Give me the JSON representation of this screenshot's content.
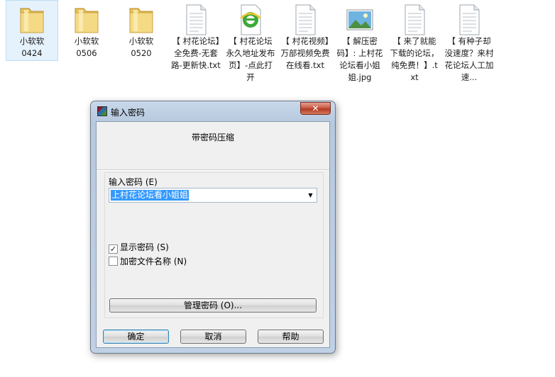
{
  "files": [
    {
      "label": "小软软\n0424",
      "icon": "folder-icon",
      "selected": true
    },
    {
      "label": "小软软\n0506",
      "icon": "folder-icon"
    },
    {
      "label": "小软软\n0520",
      "icon": "folder-icon"
    },
    {
      "label": "【 村花论坛】全免费-无套路-更新快.txt",
      "icon": "text-file-icon"
    },
    {
      "label": "【 村花论坛永久地址发布页】-点此打开",
      "icon": "ie-shortcut-icon"
    },
    {
      "label": "【 村花视频】万部视频免费在线看.txt",
      "icon": "text-file-icon"
    },
    {
      "label": "【 解压密码】: 上村花论坛看小姐姐.jpg",
      "icon": "image-file-icon"
    },
    {
      "label": "【 来了就能下载的论坛，纯免费！】.txt",
      "icon": "text-file-icon"
    },
    {
      "label": "【 有种子却没速度？来村花论坛人工加速...",
      "icon": "text-file-icon"
    }
  ],
  "dialog": {
    "title": "输入密码",
    "close_label": "✕",
    "section_title": "带密码压缩",
    "password_label": "输入密码 (E)",
    "password_value": "上村花论坛看小姐姐",
    "show_password_label": "显示密码 (S)",
    "show_password_checked": true,
    "encrypt_names_label": "加密文件名称 (N)",
    "encrypt_names_checked": false,
    "manage_label": "管理密码 (O)...",
    "ok_label": "确定",
    "cancel_label": "取消",
    "help_label": "帮助"
  }
}
